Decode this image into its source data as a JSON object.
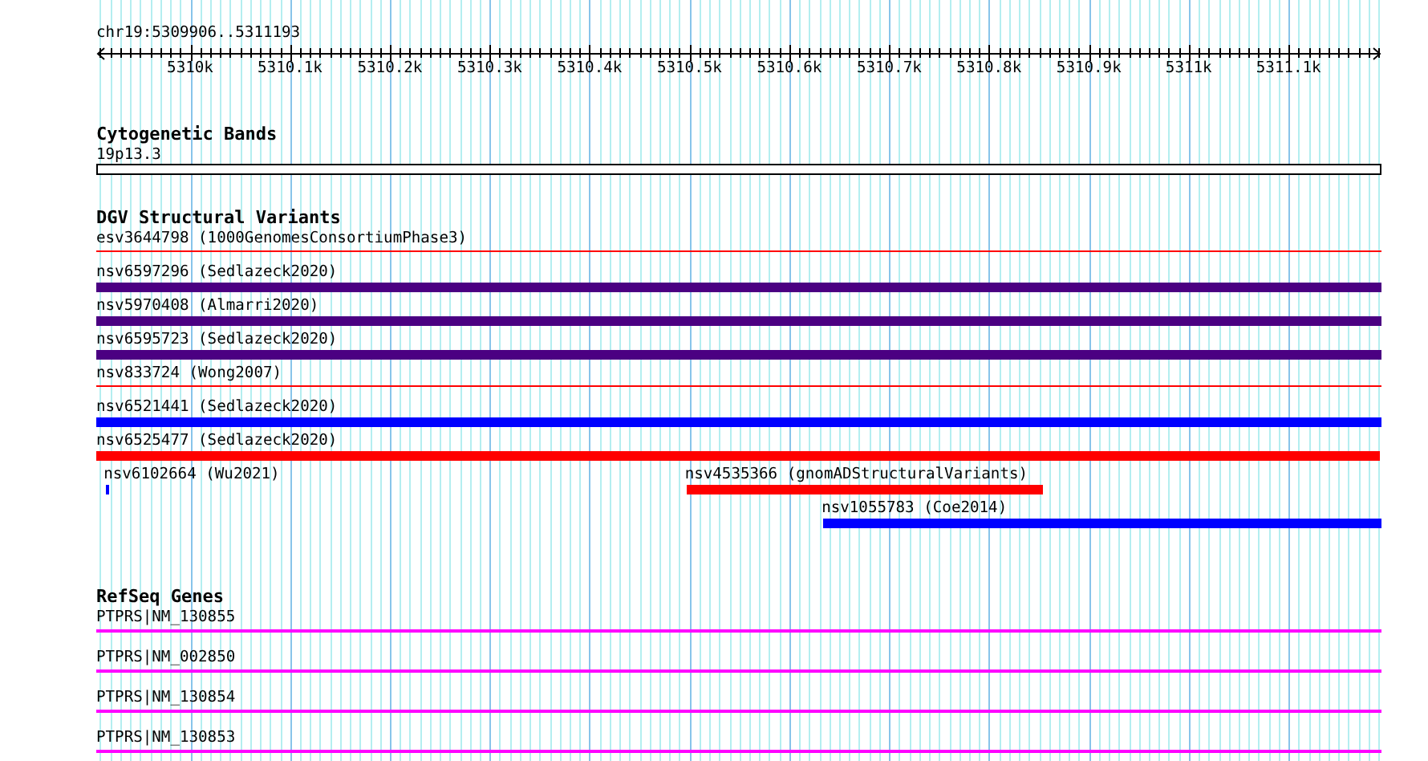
{
  "location": "chr19:5309906..5311193",
  "ruler": {
    "ticks": [
      "5310k",
      "5310.1k",
      "5310.2k",
      "5310.3k",
      "5310.4k",
      "5310.5k",
      "5310.6k",
      "5310.7k",
      "5310.8k",
      "5310.9k",
      "5311k",
      "5311.1k"
    ]
  },
  "tracks": [
    {
      "title": "Cytogenetic Bands",
      "kind": "cytoband",
      "features": [
        {
          "label": "19p13.3",
          "kind": "band",
          "color": "#ffffff"
        }
      ]
    },
    {
      "title": "DGV Structural Variants",
      "kind": "features",
      "features": [
        {
          "label": "esv3644798 (1000GenomesConsortiumPhase3)",
          "kind": "line",
          "color": "#ff0000"
        },
        {
          "label": "nsv6597296 (Sedlazeck2020)",
          "kind": "bar",
          "color": "#4b0082"
        },
        {
          "label": "nsv5970408 (Almarri2020)",
          "kind": "bar",
          "color": "#4b0082"
        },
        {
          "label": "nsv6595723 (Sedlazeck2020)",
          "kind": "bar",
          "color": "#4b0082"
        },
        {
          "label": "nsv833724 (Wong2007)",
          "kind": "line",
          "color": "#ff0000"
        },
        {
          "label": "nsv6521441 (Sedlazeck2020)",
          "kind": "bar",
          "color": "#0000ff"
        },
        {
          "label": "nsv6525477 (Sedlazeck2020)",
          "kind": "bar",
          "color": "#ff0000"
        },
        {
          "label": "nsv6102664 (Wu2021)",
          "kind": "bar",
          "color": "#0000ff"
        },
        {
          "label": "nsv4535366 (gnomADStructuralVariants)",
          "kind": "bar",
          "color": "#ff0000"
        },
        {
          "label": "nsv1055783 (Coe2014)",
          "kind": "bar",
          "color": "#0000ff"
        }
      ]
    },
    {
      "title": "RefSeq Genes",
      "kind": "genes",
      "features": [
        {
          "label": "PTPRS|NM_130855",
          "kind": "line",
          "color": "#ff00ff"
        },
        {
          "label": "PTPRS|NM_002850",
          "kind": "line",
          "color": "#ff00ff"
        },
        {
          "label": "PTPRS|NM_130854",
          "kind": "line",
          "color": "#ff00ff"
        },
        {
          "label": "PTPRS|NM_130853",
          "kind": "line",
          "color": "#ff00ff"
        }
      ]
    }
  ]
}
